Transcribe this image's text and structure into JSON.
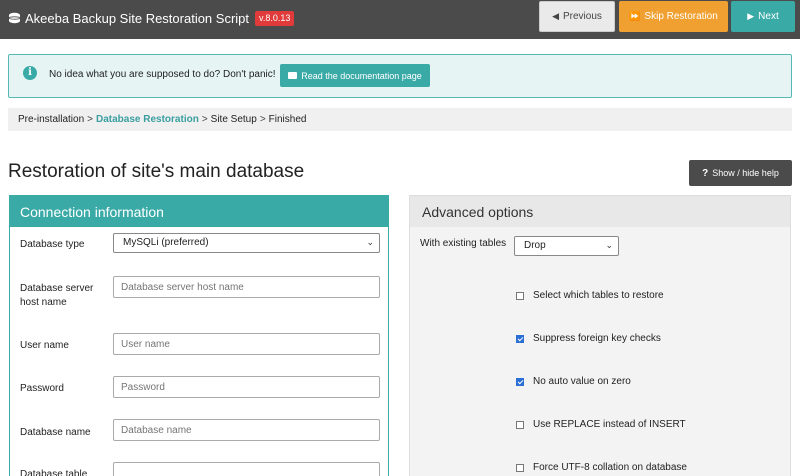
{
  "header": {
    "app_title": "Akeeba Backup Site Restoration Script",
    "version": "v.8.0.13",
    "logo_icon": "akeeba-logo-icon",
    "previous_label": "Previous",
    "skip_label": "Skip Restoration",
    "next_label": "Next"
  },
  "info": {
    "icon": "info-icon",
    "message": "No idea what you are supposed to do? Don't panic!",
    "doc_button_label": "Read the documentation page"
  },
  "breadcrumb": {
    "items": [
      "Pre-installation",
      "Database Restoration",
      "Site Setup",
      "Finished"
    ],
    "current_index": 1
  },
  "page": {
    "title": "Restoration of site's main database",
    "help_button_label": "Show / hide help"
  },
  "connection": {
    "heading": "Connection information",
    "db_type_label": "Database type",
    "db_type_value": "MySQLi (preferred)",
    "host_label": "Database server host name",
    "host_placeholder": "Database server host name",
    "user_label": "User name",
    "user_placeholder": "User name",
    "password_label": "Password",
    "password_placeholder": "Password",
    "dbname_label": "Database name",
    "dbname_placeholder": "Database name",
    "prefix_label": "Database table"
  },
  "advanced": {
    "heading": "Advanced options",
    "existing_tables_label": "With existing tables",
    "existing_tables_value": "Drop",
    "options": [
      {
        "label": "Select which tables to restore",
        "checked": false
      },
      {
        "label": "Suppress foreign key checks",
        "checked": true
      },
      {
        "label": "No auto value on zero",
        "checked": true
      },
      {
        "label": "Use REPLACE instead of INSERT",
        "checked": false
      },
      {
        "label": "Force UTF-8 collation on database",
        "checked": false
      }
    ]
  },
  "colors": {
    "accent": "#3aaaa7",
    "warning": "#f0a030",
    "topbar": "#4b4b4b",
    "badge": "#e03a3a"
  }
}
